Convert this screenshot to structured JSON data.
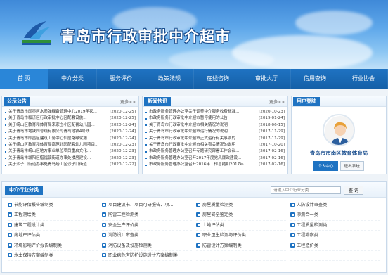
{
  "site": {
    "title": "青岛市行政审批中介超市"
  },
  "nav": [
    "首 页",
    "中介分类",
    "服务评价",
    "政策法规",
    "在线咨询",
    "审批大厅",
    "信用查询",
    "行业协会"
  ],
  "announcements": {
    "title": "公示公告",
    "more": "更多>>",
    "items": [
      {
        "t": "关于青岛市即墨区水质弹绿备管理中心2019年农...",
        "d": "[2020-12-25]"
      },
      {
        "t": "关于青岛市和济区行政审批中心区配套设施...",
        "d": "[2020-12-25]"
      },
      {
        "t": "关于崂山区教育和体育局来家庄小区配套幼儿园...",
        "d": "[2020-12-24]"
      },
      {
        "t": "关于青岛市地铁四号线有限公司青岛地铁4号线...",
        "d": "[2020-12-24]"
      },
      {
        "t": "关于青岛市即墨区建筑工务中心仙居路绿化施...",
        "d": "[2020-12-24]"
      },
      {
        "t": "关于崂山区教育和体育局嘉苑北园配套幼儿园项目...",
        "d": "[2020-12-23]"
      },
      {
        "t": "关于青岛市崂山区地方事业单位项目重启文化...",
        "d": "[2020-12-23]"
      },
      {
        "t": "关于青岛市城阳区惜福镇街道办事处楼房建设...",
        "d": "[2020-12-23]"
      },
      {
        "t": "关于沙子口街道办事处青岛崂山区沙子口街道...",
        "d": "[2020-12-22]"
      }
    ]
  },
  "news": {
    "title": "新闻快讯",
    "more": "更多>>",
    "items": [
      {
        "t": "市政务服务管理办公室关于调整中介服务收费标准...",
        "d": "[2020-10-23]"
      },
      {
        "t": "市政务服务行政审批中介超市暂停使用的公告",
        "d": "[2019-01-24]"
      },
      {
        "t": "关于青岛市行政审批中介超市相关情况的说明",
        "d": "[2018-06-15]"
      },
      {
        "t": "关于青岛市行政审批中介超市运行情况的说明",
        "d": "[2017-11-29]"
      },
      {
        "t": "关于青岛市行政审批中介超市正式运行有关事项的...",
        "d": "[2017-11-29]"
      },
      {
        "t": "关于青岛市行政审批中介超市相关有关情况的说明",
        "d": "[2017-10-20]"
      },
      {
        "t": "市政务服务管理办公室召开专题研究部署工作会议...",
        "d": "[2017-02-16]"
      },
      {
        "t": "市政务服务管理办公室召开2017年度党风廉政建设...",
        "d": "[2017-02-16]"
      },
      {
        "t": "市政务服务管理办公室召开2016年工作总结和2017年...",
        "d": "[2017-02-16]"
      }
    ]
  },
  "user": {
    "title": "用户登陆",
    "org_name": "青岛市市南区教育体育局",
    "btn_center": "个人中心",
    "btn_logout": "退出系统"
  },
  "category": {
    "title": "中介行业分类",
    "search_placeholder": "请输入中介行业分类",
    "search_btn": "查 询",
    "items": [
      "节能评估报告编制类",
      "项目建议书、项目可研报告、项...",
      "房屋质量检测类",
      "人防设计审查类",
      "工程测绘类",
      "防雷工程检测类",
      "房屋安全鉴定类",
      "渗测合一类",
      "建筑工程设计类",
      "安全生产评价类",
      "土地评估类",
      "工程质量检测类",
      "房地产评估类",
      "消防设计审查类",
      "职业卫生检测与评价类",
      "工程勘察类",
      "环境影响评价报告编制类",
      "消防设备及设施检测类",
      "防雷设计方案编制类",
      "工程造价类",
      "水土保持方案编制类",
      "职业病危害防护设施设计方案编制类",
      "",
      ""
    ]
  },
  "colors": {
    "brand": "#1f73c2",
    "title_outline": "#1b4f8f"
  }
}
